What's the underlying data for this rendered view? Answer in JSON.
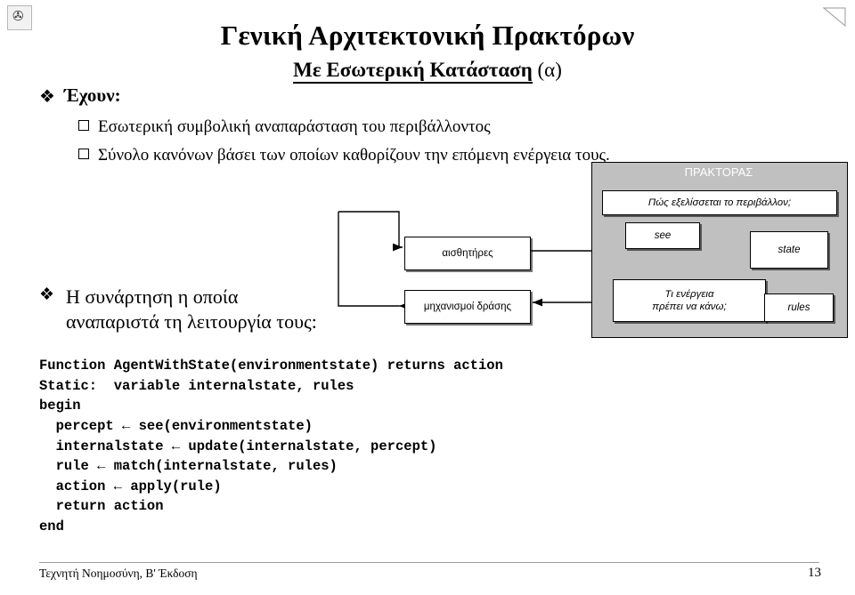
{
  "slide": {
    "title_main": "Γενική Αρχιτεκτονική Πρακτόρων",
    "title_sub": "Με Εσωτερική Κατάσταση",
    "title_sub_tag": "(α)"
  },
  "bullets": {
    "b1_label": "Έχουν:",
    "b1_items": [
      "Εσωτερική συμβολική αναπαράσταση του περιβάλλοντος",
      "Σύνολο κανόνων βάσει των οποίων καθορίζουν την επόμενη ενέργεια τους."
    ],
    "b2_line1": "Η συνάρτηση η οποία",
    "b2_line2": "αναπαριστά τη λειτουργία τους:"
  },
  "diagram": {
    "agent_title": "ΠΡΑΚΤΟΡΑΣ",
    "env_question": "Πώς εξελίσσεται το περιβάλλον;",
    "sensors": "αισθητήρες",
    "actuators": "μηχανισμοί δράσης",
    "see": "see",
    "state": "state",
    "action_question": "Τι ενέργεια\nπρέπει να κάνω;",
    "rules": "rules"
  },
  "code": {
    "text": "Function AgentWithState(environmentstate) returns action\nStatic:  variable internalstate, rules\nbegin\n  percept ← see(environmentstate)\n  internalstate ← update(internalstate, percept)\n  rule ← match(internalstate, rules)\n  action ← apply(rule)\n  return action\nend"
  },
  "footer": {
    "left": "Τεχνητή Νοημοσύνη, Β' Έκδοση",
    "page": "13"
  },
  "icons": {
    "diamond": "❖",
    "corner_glyph": "✇"
  },
  "colors": {
    "agent_fill": "#c0c0c0",
    "text": "#000000",
    "footer_rule": "#9a9a9a"
  }
}
